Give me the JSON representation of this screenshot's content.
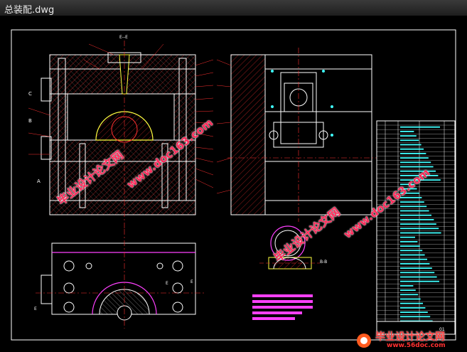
{
  "window": {
    "title": "总装配.dwg"
  },
  "drawing": {
    "section_label": "E--E",
    "section_label_2": "B-B",
    "left_markers": [
      "C",
      "B",
      "A"
    ],
    "side_markers": [
      "E",
      "E",
      "E"
    ],
    "title_block_code": "01"
  },
  "watermarks": {
    "url": "www.doc163.com",
    "cn": "毕业设计论文网"
  },
  "footer": {
    "cn": "毕业设计论文网",
    "url": "www.56doc.com"
  },
  "colors": {
    "frame": "#ffffff",
    "lines": "#ffffff",
    "hatch": "#ff3030",
    "yellow": "#ffff40",
    "cyan": "#40ffff",
    "magenta": "#ff40ff",
    "blue": "#4060ff"
  }
}
